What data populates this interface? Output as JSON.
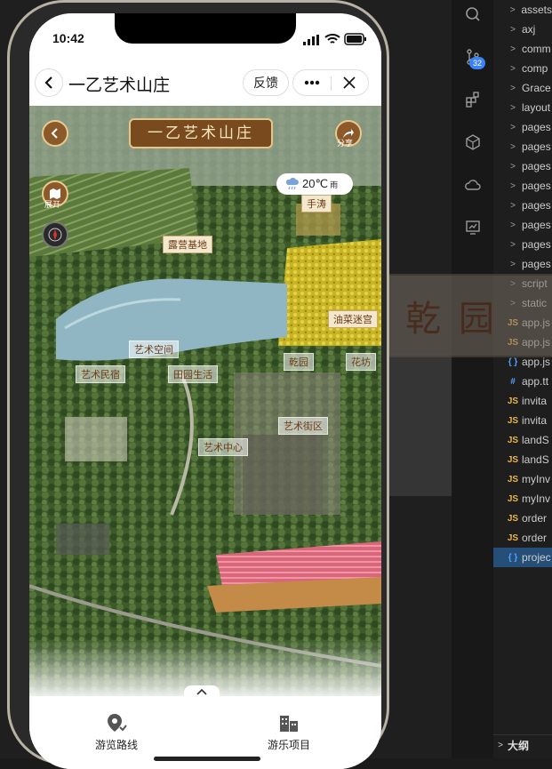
{
  "phone": {
    "time": "10:42",
    "nav": {
      "title": "一乙艺术山庄",
      "feedback": "反馈"
    },
    "map": {
      "plaque_title": "一乙艺术山庄",
      "expand_label": "展开",
      "share_label": "分享",
      "weather": {
        "temp": "20℃",
        "desc": "雨"
      },
      "labels": {
        "tea": "手涛",
        "camping": "露营基地",
        "rapeseed": "油菜迷宫",
        "label_a": "乾园",
        "label_b": "艺术民宿",
        "label_c": "艺术中心",
        "label_d": "艺术街区",
        "label_e": "田园生活",
        "label_f": "艺术空间",
        "label_g": "花坊"
      }
    },
    "tabs": [
      {
        "label": "游览路线",
        "icon": "route-pin-icon"
      },
      {
        "label": "游乐项目",
        "icon": "buildings-icon"
      }
    ]
  },
  "ide": {
    "badge": "32",
    "explorer": [
      {
        "type": "folder",
        "name": "assets"
      },
      {
        "type": "folder",
        "name": "axj"
      },
      {
        "type": "folder",
        "name": "comm"
      },
      {
        "type": "folder",
        "name": "comp"
      },
      {
        "type": "folder",
        "name": "Grace"
      },
      {
        "type": "folder",
        "name": "layout"
      },
      {
        "type": "folder",
        "name": "pages"
      },
      {
        "type": "folder",
        "name": "pages"
      },
      {
        "type": "folder",
        "name": "pages"
      },
      {
        "type": "folder",
        "name": "pages"
      },
      {
        "type": "folder",
        "name": "pages"
      },
      {
        "type": "folder",
        "name": "pages"
      },
      {
        "type": "folder",
        "name": "pages"
      },
      {
        "type": "folder",
        "name": "pages"
      },
      {
        "type": "folder",
        "name": "script"
      },
      {
        "type": "folder",
        "name": "static"
      },
      {
        "type": "js",
        "name": "app.js"
      },
      {
        "type": "js",
        "name": "app.js"
      },
      {
        "type": "json",
        "name": "app.js"
      },
      {
        "type": "hash",
        "name": "app.tt"
      },
      {
        "type": "js",
        "name": "invita"
      },
      {
        "type": "js",
        "name": "invita"
      },
      {
        "type": "js",
        "name": "landS"
      },
      {
        "type": "js",
        "name": "landS"
      },
      {
        "type": "js",
        "name": "myInv"
      },
      {
        "type": "js",
        "name": "myInv"
      },
      {
        "type": "js",
        "name": "order"
      },
      {
        "type": "js",
        "name": "order"
      },
      {
        "type": "json",
        "name": "projec",
        "selected": true
      }
    ],
    "outline": "大纲",
    "ghost_text": "乾园"
  },
  "colors": {
    "accent_blue": "#3b82f6",
    "plaque_brown": "#7a4a1f",
    "gold": "#e6c58b"
  }
}
